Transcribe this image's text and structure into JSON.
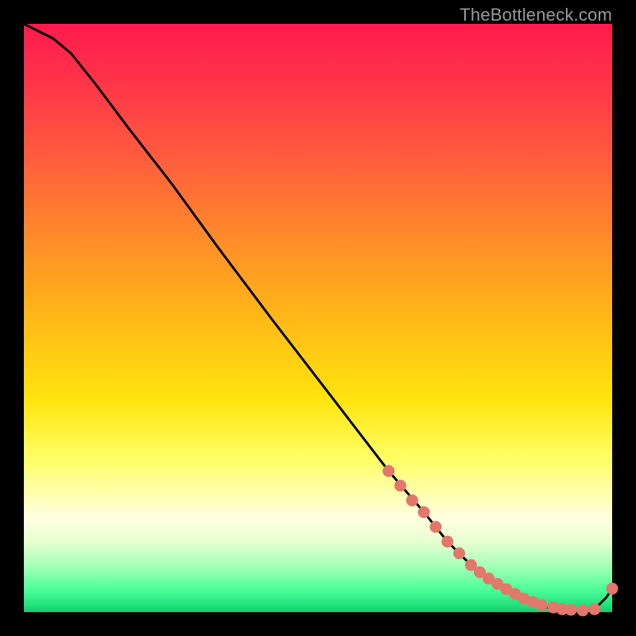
{
  "watermark": {
    "text": "TheBottleneck.com"
  },
  "colors": {
    "bg": "#000000",
    "curve": "#000000",
    "marker": "#e2776b",
    "gradient_top": "#ff1a4d",
    "gradient_bottom": "#17c76e"
  },
  "chart_data": {
    "type": "line",
    "title": "",
    "xlabel": "",
    "ylabel": "",
    "xlim": [
      0,
      100
    ],
    "ylim": [
      0,
      100
    ],
    "grid": false,
    "legend": null,
    "series": [
      {
        "name": "bottleneck-curve",
        "x": [
          0,
          2,
          5,
          8,
          12,
          18,
          25,
          33,
          42,
          52,
          62,
          68,
          72,
          76,
          80,
          83,
          86,
          89,
          92,
          95,
          97,
          99,
          100
        ],
        "values": [
          100,
          99,
          97.5,
          95,
          90,
          82,
          73,
          62,
          50,
          37,
          24,
          17,
          12,
          8,
          5,
          3,
          1.5,
          0.8,
          0.4,
          0.3,
          0.5,
          2.5,
          4
        ]
      }
    ],
    "markers": {
      "name": "highlighted-points",
      "x": [
        62,
        64,
        66,
        68,
        70,
        72,
        74,
        76,
        77.5,
        79,
        80.5,
        82,
        83.5,
        85,
        86.5,
        88,
        90,
        91.5,
        93,
        95,
        97,
        100
      ],
      "y": [
        24,
        21.5,
        19,
        17,
        14.5,
        12,
        10,
        8,
        6.8,
        5.7,
        4.8,
        3.9,
        3.1,
        2.3,
        1.7,
        1.2,
        0.8,
        0.5,
        0.4,
        0.3,
        0.5,
        4
      ]
    }
  }
}
